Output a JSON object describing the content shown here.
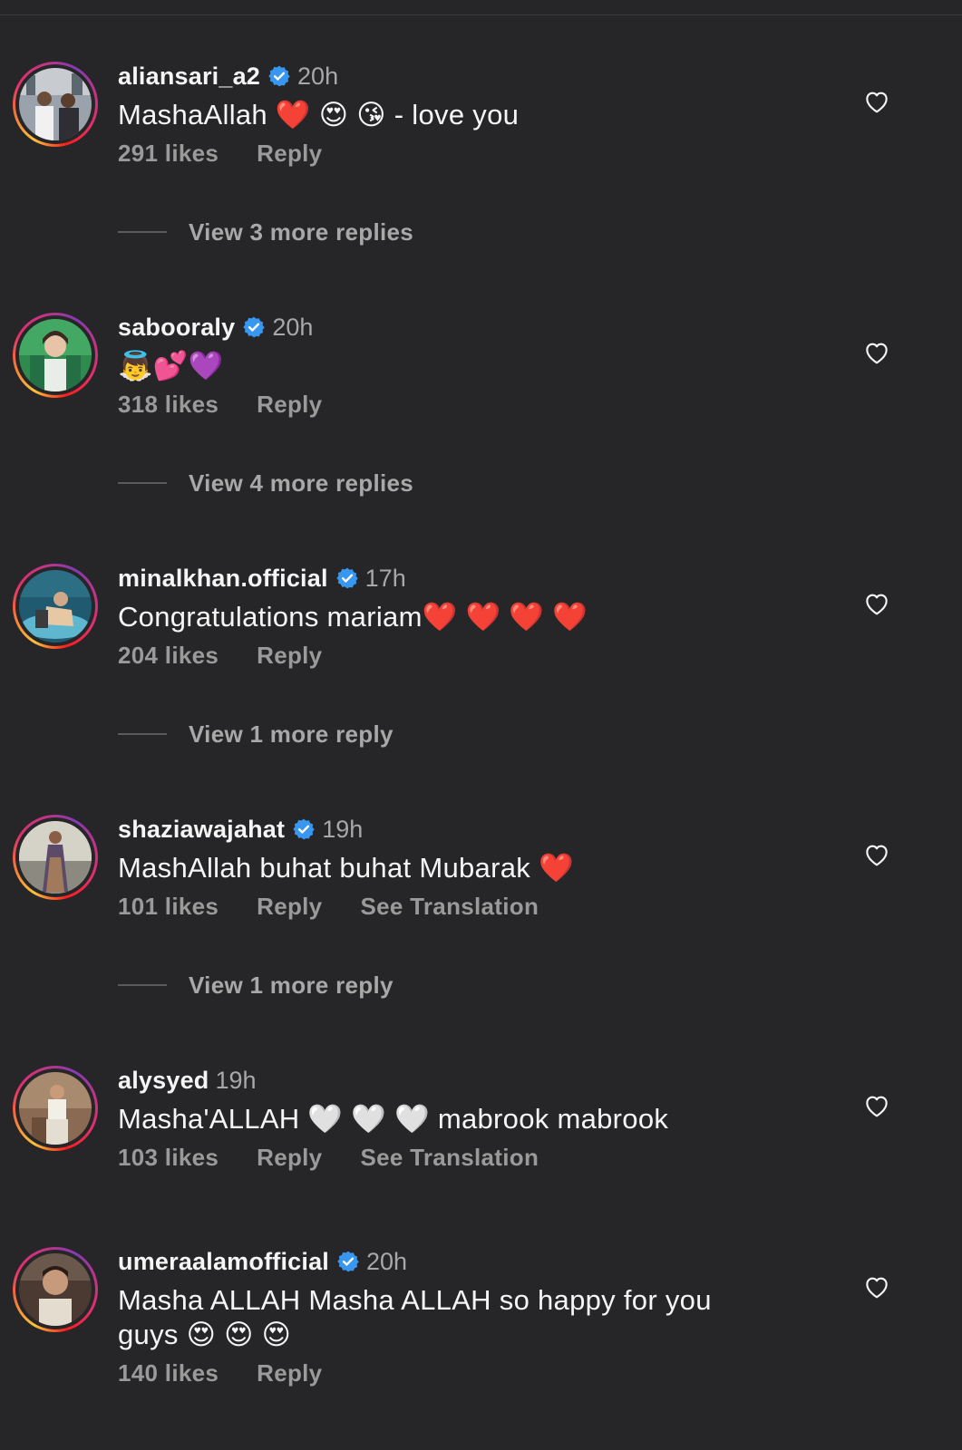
{
  "colors": {
    "background": "#262628",
    "primary_text": "#f5f5f5",
    "secondary_text": "#9a9a9a",
    "verified_badge": "#3897f0",
    "story_ring": [
      "#f9c33b",
      "#e1306c",
      "#833ab4"
    ]
  },
  "comments": [
    {
      "username": "aliansari_a2",
      "verified": true,
      "time": "20h",
      "text": "MashaAllah ❤️ 😍 😘  - love you",
      "likes": "291 likes",
      "reply": "Reply",
      "view_replies": "View 3 more replies"
    },
    {
      "username": "sabooraly",
      "verified": true,
      "time": "20h",
      "text": "👼💕💜",
      "likes": "318 likes",
      "reply": "Reply",
      "view_replies": "View 4 more replies"
    },
    {
      "username": "minalkhan.official",
      "verified": true,
      "time": "17h",
      "text": "Congratulations mariam❤️ ❤️ ❤️ ❤️",
      "likes": "204 likes",
      "reply": "Reply",
      "view_replies": "View 1 more reply"
    },
    {
      "username": "shaziawajahat",
      "verified": true,
      "time": "19h",
      "text": "MashAllah buhat buhat Mubarak  ❤️",
      "likes": "101 likes",
      "reply": "Reply",
      "see_translation": "See Translation",
      "view_replies": "View 1 more reply"
    },
    {
      "username": "alysyed",
      "verified": false,
      "time": "19h",
      "text": "Masha'ALLAH 🤍 🤍 🤍  mabrook mabrook",
      "likes": "103 likes",
      "reply": "Reply",
      "see_translation": "See Translation"
    },
    {
      "username": "umeraalamofficial",
      "verified": true,
      "time": "20h",
      "text": "Masha ALLAH Masha ALLAH so happy for you guys 😍 😍 😍",
      "likes": "140 likes",
      "reply": "Reply"
    }
  ],
  "icons": {
    "verified": "verified-badge-icon",
    "like": "heart-outline-icon"
  }
}
